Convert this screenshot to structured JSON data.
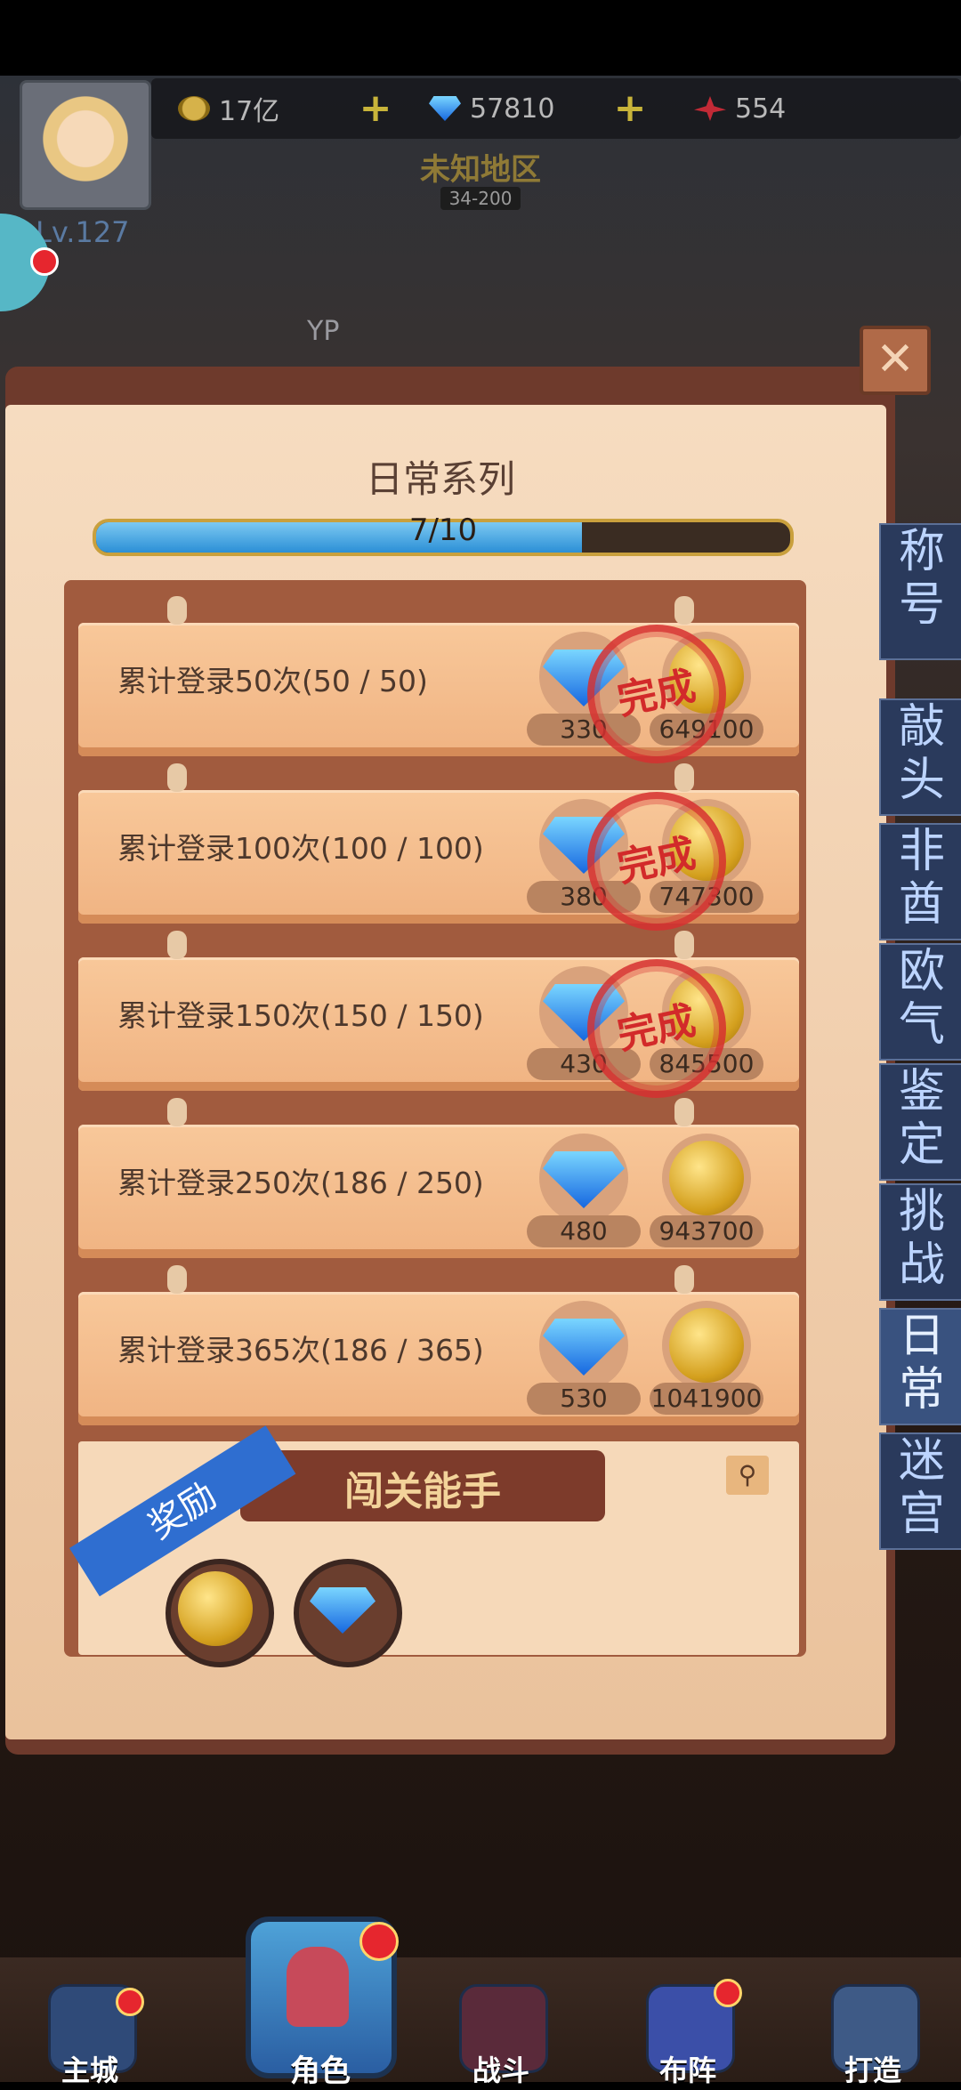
{
  "colors": {
    "accent_blue": "#2b8fd6",
    "stamp_red": "#d22a2a",
    "paper": "#f1cfae"
  },
  "top": {
    "gold": "17亿",
    "gems": "57810",
    "crystals": "554",
    "level": "Lv.127",
    "region": "未知地区",
    "region_sub": "34-200",
    "player_name": "YP"
  },
  "panel": {
    "title": "日常系列",
    "progress": {
      "text": "7/10",
      "value": 7,
      "max": 10
    },
    "close_icon": "close-icon"
  },
  "rows": [
    {
      "label": "累计登录50次(50 / 50)",
      "gems": "330",
      "gold": "649100",
      "stamp": "完成"
    },
    {
      "label": "累计登录100次(100 / 100)",
      "gems": "380",
      "gold": "747300",
      "stamp": "完成"
    },
    {
      "label": "累计登录150次(150 / 150)",
      "gems": "430",
      "gold": "845500",
      "stamp": "完成"
    },
    {
      "label": "累计登录250次(186 / 250)",
      "gems": "480",
      "gold": "943700",
      "stamp": ""
    },
    {
      "label": "累计登录365次(186 / 365)",
      "gems": "530",
      "gold": "1041900",
      "stamp": ""
    }
  ],
  "reward": {
    "ribbon": "奖励",
    "title": "闯关能手",
    "icons": [
      "gold-coin-icon",
      "gem-icon"
    ]
  },
  "side_tabs": [
    "称号",
    "敲头",
    "非酋",
    "欧气",
    "鉴定",
    "挑战",
    "日常",
    "迷宫"
  ],
  "active_tab": 6,
  "nav": {
    "main_city": "主城",
    "character": "角色",
    "battle": "战斗",
    "formation": "布阵",
    "forge": "打造"
  }
}
